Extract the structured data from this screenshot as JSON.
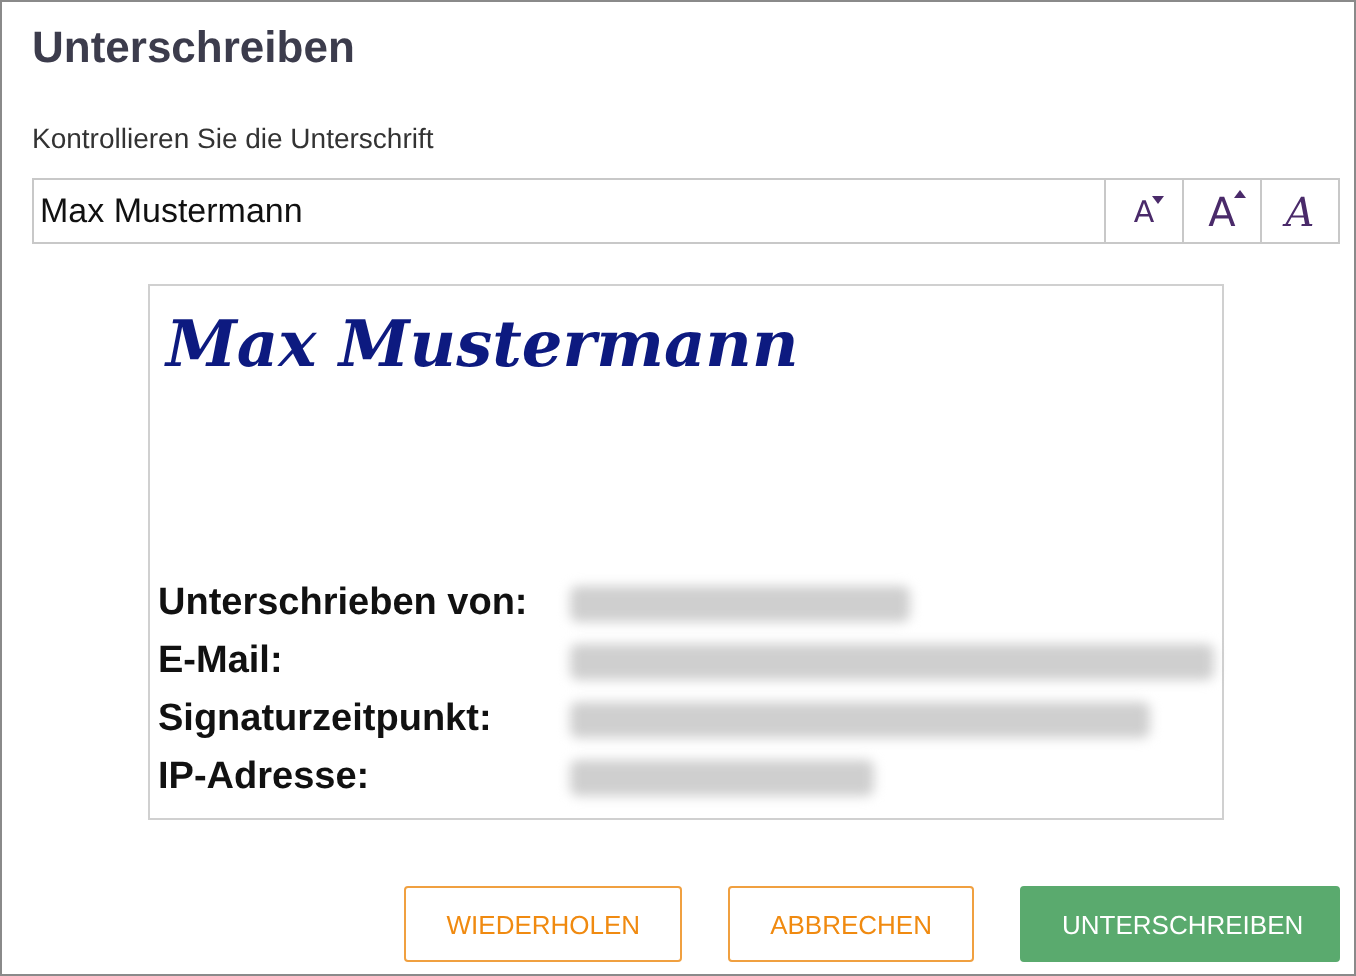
{
  "dialog": {
    "title": "Unterschreiben",
    "subtitle": "Kontrollieren Sie die Unterschrift"
  },
  "name_field": {
    "value": "Max Mustermann"
  },
  "font_buttons": [
    {
      "kind": "smaller",
      "label": "A"
    },
    {
      "kind": "larger",
      "label": "A"
    },
    {
      "kind": "style",
      "label": "A"
    }
  ],
  "preview": {
    "signature": "Max Mustermann",
    "fields": [
      {
        "label": "Unterschrieben von:",
        "redacted": true
      },
      {
        "label": "E-Mail:",
        "redacted": true
      },
      {
        "label": "Signaturzeitpunkt:",
        "redacted": true
      },
      {
        "label": "IP-Adresse:",
        "redacted": true
      }
    ]
  },
  "buttons": [
    {
      "kind": "outline",
      "label": "WIEDERHOLEN"
    },
    {
      "kind": "outline",
      "label": "ABBRECHEN"
    },
    {
      "kind": "primary",
      "label": "UNTERSCHREIBEN"
    }
  ]
}
